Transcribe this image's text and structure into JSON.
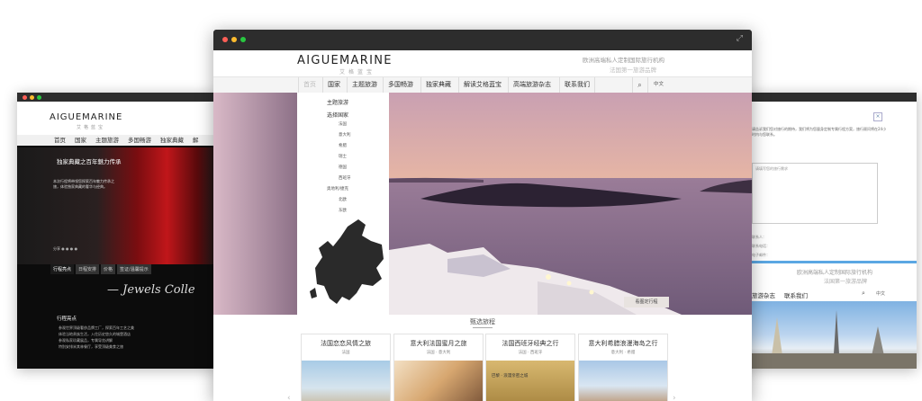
{
  "left_window": {
    "logo": "AIGUEMARINE",
    "logo_sub": "艾格蓝宝",
    "nav": [
      "首页",
      "国家",
      "主题旅游",
      "多国畅游",
      "独家典藏",
      "解"
    ],
    "hero_title": "独家典藏之百年魅力传承",
    "hero_text": "本次行程将带领您探索百年魅力传承之旅，体验独家典藏的奢华与经典。",
    "share_label": "分享",
    "tabs": [
      "行程亮点",
      "日程安排",
      "价格",
      "签证/温馨提示"
    ],
    "script_text": "— Jewels Colle",
    "features_title": "行程亮点",
    "features": [
      "参观世界顶级奢侈品牌工厂，探索百年工艺之美",
      "体验当地贵族生活，入住历史悠久的城堡酒店",
      "参观私家珍藏展品，专属导览讲解",
      "特别安排米其林餐厅，享受顶级美食之旅"
    ]
  },
  "right_window": {
    "close_icon": "×",
    "intro": "请告诉我们您对旅行的期待，我们将为您量身定制专属行程方案，旅行顾问将在24小时内与您联系。",
    "textarea_placeholder": "请填写您的旅行需求",
    "fields": [
      "联系人：",
      "联系电话：",
      "电子邮件："
    ],
    "slogan1": "欧洲高端私人定制国际旅行机构",
    "slogan2": "法国第一旅游品牌",
    "nav": [
      "旅游杂志",
      "联系我们"
    ],
    "lang": "中文"
  },
  "main_window": {
    "logo": "AIGUEMARINE",
    "logo_sub": "艾格蓝宝",
    "slogan1": "欧洲高端私人定制国际旅行机构",
    "slogan2": "法国第一旅游品牌",
    "nav": [
      "首页",
      "国家",
      "主题旅游",
      "多国畅游",
      "独家典藏",
      "解读艾格蓝宝",
      "高端旅游杂志",
      "联系我们"
    ],
    "lang": "中文",
    "submenu": {
      "theme": "主题旅游",
      "choose_country": "选择国家",
      "countries": [
        "法国",
        "意大利",
        "希腊",
        "瑞士",
        "德国",
        "西班牙",
        "奥地利/捷克",
        "北欧",
        "东欧"
      ]
    },
    "book_button": "看图定行程",
    "featured_title": "甄选旅程",
    "cards": [
      {
        "title": "法国恋恋风情之旅",
        "sub": "法国"
      },
      {
        "title": "意大利法国蜜月之旅",
        "sub": "法国 · 意大利"
      },
      {
        "title": "法国西班牙经典之行",
        "sub": "法国 · 西班牙"
      },
      {
        "title": "意大利希腊浪漫海岛之行",
        "sub": "意大利 · 希腊"
      }
    ],
    "card3_overlay": "巴黎 · 浪漫亲密之城"
  },
  "colors": {
    "accent": "#5ba7e3",
    "titlebar": "#2d2d2d",
    "sunset_top": "#d9a4a8",
    "sea": "#8a6f88"
  }
}
